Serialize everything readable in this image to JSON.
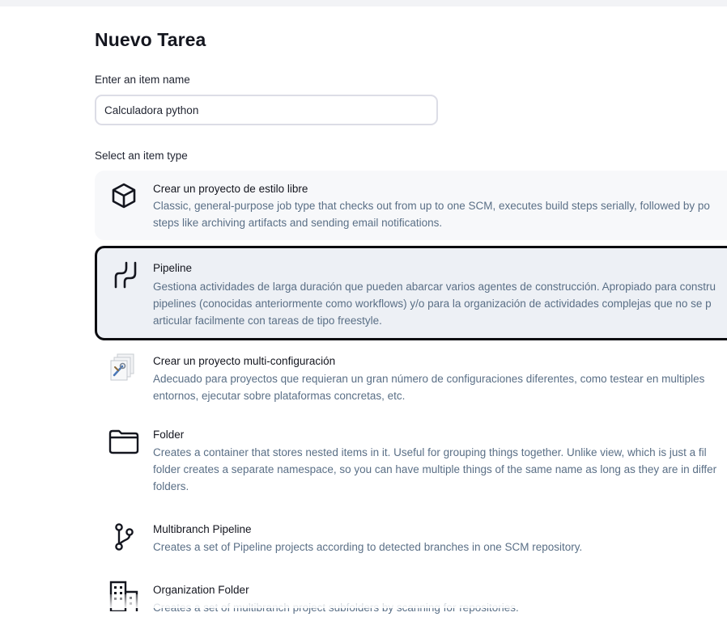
{
  "page": {
    "title": "Nuevo Tarea"
  },
  "name_field": {
    "label": "Enter an item name",
    "value": "Calculadora python"
  },
  "type_section": {
    "label": "Select an item type"
  },
  "item_types": [
    {
      "name": "Crear un proyecto de estilo libre",
      "description": "Classic, general-purpose job type that checks out from up to one SCM, executes build steps serially, followed by po\nsteps like archiving artifacts and sending email notifications.",
      "icon": "cube-icon",
      "selected": false
    },
    {
      "name": "Pipeline",
      "description": "Gestiona actividades de larga duración que pueden abarcar varios agentes de construcción. Apropiado para constru\npipelines (conocidas anteriormente como workflows) y/o para la organización de actividades complejas que no se p\narticular facilmente con tareas de tipo freestyle.",
      "icon": "pipeline-icon",
      "selected": true
    },
    {
      "name": "Crear un proyecto multi-configuración",
      "description": "Adecuado para proyectos que requieran un gran número de configuraciones diferentes, como testear en multiples\nentornos, ejecutar sobre plataformas concretas, etc.",
      "icon": "multi-config-icon",
      "selected": false
    },
    {
      "name": "Folder",
      "description": "Creates a container that stores nested items in it. Useful for grouping things together. Unlike view, which is just a fil\nfolder creates a separate namespace, so you can have multiple things of the same name as long as they are in differ\nfolders.",
      "icon": "folder-icon",
      "selected": false
    },
    {
      "name": "Multibranch Pipeline",
      "description": "Creates a set of Pipeline projects according to detected branches in one SCM repository.",
      "icon": "git-branch-icon",
      "selected": false
    },
    {
      "name": "Organization Folder",
      "description": "Creates a set of multibranch project subfolders by scanning for repositories.",
      "icon": "building-icon",
      "selected": false
    }
  ],
  "colors": {
    "description_text": "#5a6f86",
    "selected_background": "#edf0f5",
    "selected_border": "#0c0c10",
    "input_border": "#dcdde6"
  }
}
